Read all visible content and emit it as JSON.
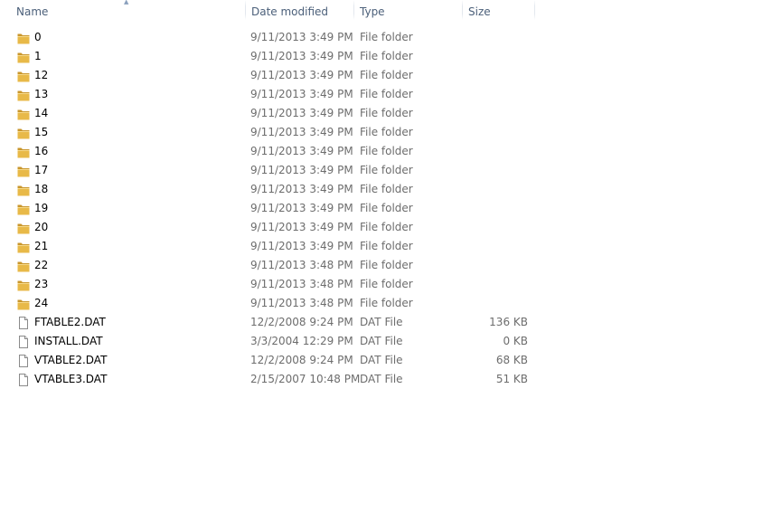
{
  "columns": {
    "name": "Name",
    "date": "Date modified",
    "type": "Type",
    "size": "Size"
  },
  "sort": {
    "column": "name",
    "direction": "ascending",
    "icon": "sort-up-arrow-icon"
  },
  "colors": {
    "folder": "#e8b948",
    "folder_dark": "#c9962c",
    "name_text": "#000000",
    "meta_text": "#6d6d6d",
    "header_text": "#4c607a"
  },
  "files": [
    {
      "name": "0",
      "date": "9/11/2013 3:49 PM",
      "type": "File folder",
      "size": "",
      "icon": "folder-icon"
    },
    {
      "name": "1",
      "date": "9/11/2013 3:49 PM",
      "type": "File folder",
      "size": "",
      "icon": "folder-icon"
    },
    {
      "name": "12",
      "date": "9/11/2013 3:49 PM",
      "type": "File folder",
      "size": "",
      "icon": "folder-icon"
    },
    {
      "name": "13",
      "date": "9/11/2013 3:49 PM",
      "type": "File folder",
      "size": "",
      "icon": "folder-icon"
    },
    {
      "name": "14",
      "date": "9/11/2013 3:49 PM",
      "type": "File folder",
      "size": "",
      "icon": "folder-icon"
    },
    {
      "name": "15",
      "date": "9/11/2013 3:49 PM",
      "type": "File folder",
      "size": "",
      "icon": "folder-icon"
    },
    {
      "name": "16",
      "date": "9/11/2013 3:49 PM",
      "type": "File folder",
      "size": "",
      "icon": "folder-icon"
    },
    {
      "name": "17",
      "date": "9/11/2013 3:49 PM",
      "type": "File folder",
      "size": "",
      "icon": "folder-icon"
    },
    {
      "name": "18",
      "date": "9/11/2013 3:49 PM",
      "type": "File folder",
      "size": "",
      "icon": "folder-icon"
    },
    {
      "name": "19",
      "date": "9/11/2013 3:49 PM",
      "type": "File folder",
      "size": "",
      "icon": "folder-icon"
    },
    {
      "name": "20",
      "date": "9/11/2013 3:49 PM",
      "type": "File folder",
      "size": "",
      "icon": "folder-icon"
    },
    {
      "name": "21",
      "date": "9/11/2013 3:49 PM",
      "type": "File folder",
      "size": "",
      "icon": "folder-icon"
    },
    {
      "name": "22",
      "date": "9/11/2013 3:48 PM",
      "type": "File folder",
      "size": "",
      "icon": "folder-icon"
    },
    {
      "name": "23",
      "date": "9/11/2013 3:48 PM",
      "type": "File folder",
      "size": "",
      "icon": "folder-icon"
    },
    {
      "name": "24",
      "date": "9/11/2013 3:48 PM",
      "type": "File folder",
      "size": "",
      "icon": "folder-icon"
    },
    {
      "name": "FTABLE2.DAT",
      "date": "12/2/2008 9:24 PM",
      "type": "DAT File",
      "size": "136 KB",
      "icon": "file-icon"
    },
    {
      "name": "INSTALL.DAT",
      "date": "3/3/2004 12:29 PM",
      "type": "DAT File",
      "size": "0 KB",
      "icon": "file-icon"
    },
    {
      "name": "VTABLE2.DAT",
      "date": "12/2/2008 9:24 PM",
      "type": "DAT File",
      "size": "68 KB",
      "icon": "file-icon"
    },
    {
      "name": "VTABLE3.DAT",
      "date": "2/15/2007 10:48 PM",
      "type": "DAT File",
      "size": "51 KB",
      "icon": "file-icon"
    }
  ]
}
